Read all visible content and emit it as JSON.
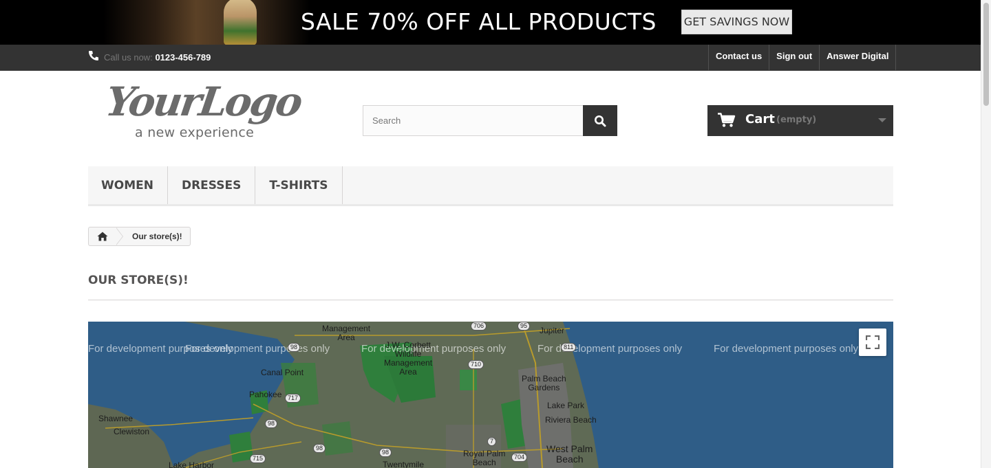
{
  "promo": {
    "text": "SALE 70% OFF ALL PRODUCTS",
    "button_label": "GET SAVINGS NOW"
  },
  "topbar": {
    "call_label": "Call us now:",
    "phone_number": "0123-456-789",
    "links": [
      "Contact us",
      "Sign out",
      "Answer Digital"
    ]
  },
  "logo": {
    "main": "YourLogo",
    "tagline": "a new experience"
  },
  "search": {
    "placeholder": "Search",
    "value": ""
  },
  "cart": {
    "label": "Cart",
    "status": "(empty)"
  },
  "menu": {
    "items": [
      "WOMEN",
      "DRESSES",
      "T-SHIRTS"
    ]
  },
  "breadcrumb": {
    "current": "Our store(s)!"
  },
  "page": {
    "heading": "OUR STORE(S)!"
  },
  "map": {
    "watermark": "For development purposes only",
    "places": {
      "management_area": "Management\nArea",
      "jw_corbett": "J.W. Corbett\nWildlife\nManagement\nArea",
      "canal_point": "Canal Point",
      "pahokee": "Pahokee",
      "shawnee": "Shawnee",
      "clewiston": "Clewiston",
      "lake_harbor": "Lake Harbor",
      "twentymile": "Twentymile",
      "jupiter": "Jupiter",
      "palm_beach_gardens": "Palm Beach\nGardens",
      "lake_park": "Lake Park",
      "riviera_beach": "Riviera Beach",
      "royal_palm_beach": "Royal Palm\nBeach",
      "west_palm_beach": "West Palm\nBeach"
    },
    "shields": [
      "706",
      "95",
      "98",
      "710",
      "811",
      "717",
      "98",
      "98",
      "98",
      "7",
      "715",
      "704"
    ],
    "fullscreen_icon": "fullscreen-icon",
    "colors": {
      "water": "#2f5d87",
      "land": "#5f6a55",
      "park": "#2f7f3c"
    }
  }
}
